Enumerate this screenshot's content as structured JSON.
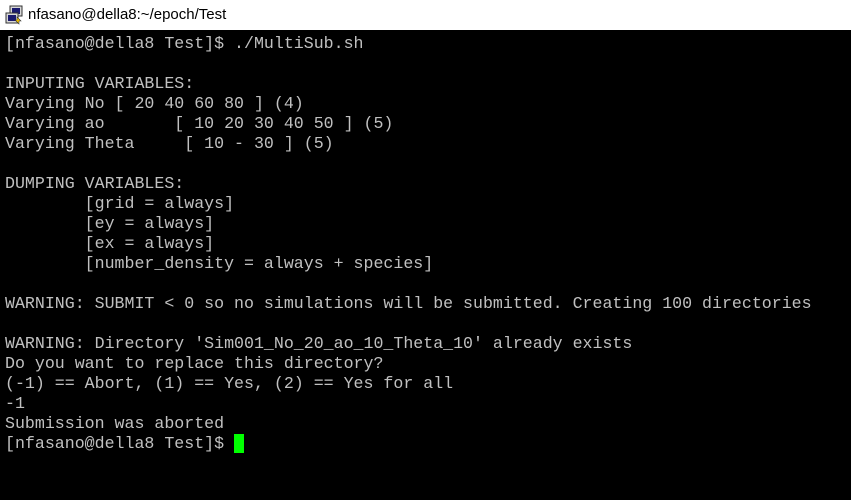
{
  "window": {
    "title": "nfasano@della8:~/epoch/Test",
    "icon": "putty-icon"
  },
  "colors": {
    "background": "#000000",
    "text": "#c0c0c0",
    "cursor": "#00ff00",
    "titlebar": "#ffffff"
  },
  "terminal": {
    "lines": [
      "[nfasano@della8 Test]$ ./MultiSub.sh",
      "",
      "INPUTING VARIABLES:",
      "Varying No [ 20 40 60 80 ] (4)",
      "Varying ao       [ 10 20 30 40 50 ] (5)",
      "Varying Theta     [ 10 - 30 ] (5)",
      "",
      "DUMPING VARIABLES:",
      "        [grid = always]",
      "        [ey = always]",
      "        [ex = always]",
      "        [number_density = always + species]",
      "",
      "WARNING: SUBMIT < 0 so no simulations will be submitted. Creating 100 directories",
      "",
      "WARNING: Directory 'Sim001_No_20_ao_10_Theta_10' already exists",
      "Do you want to replace this directory?",
      "(-1) == Abort, (1) == Yes, (2) == Yes for all",
      "-1",
      "Submission was aborted",
      "[nfasano@della8 Test]$ "
    ]
  }
}
